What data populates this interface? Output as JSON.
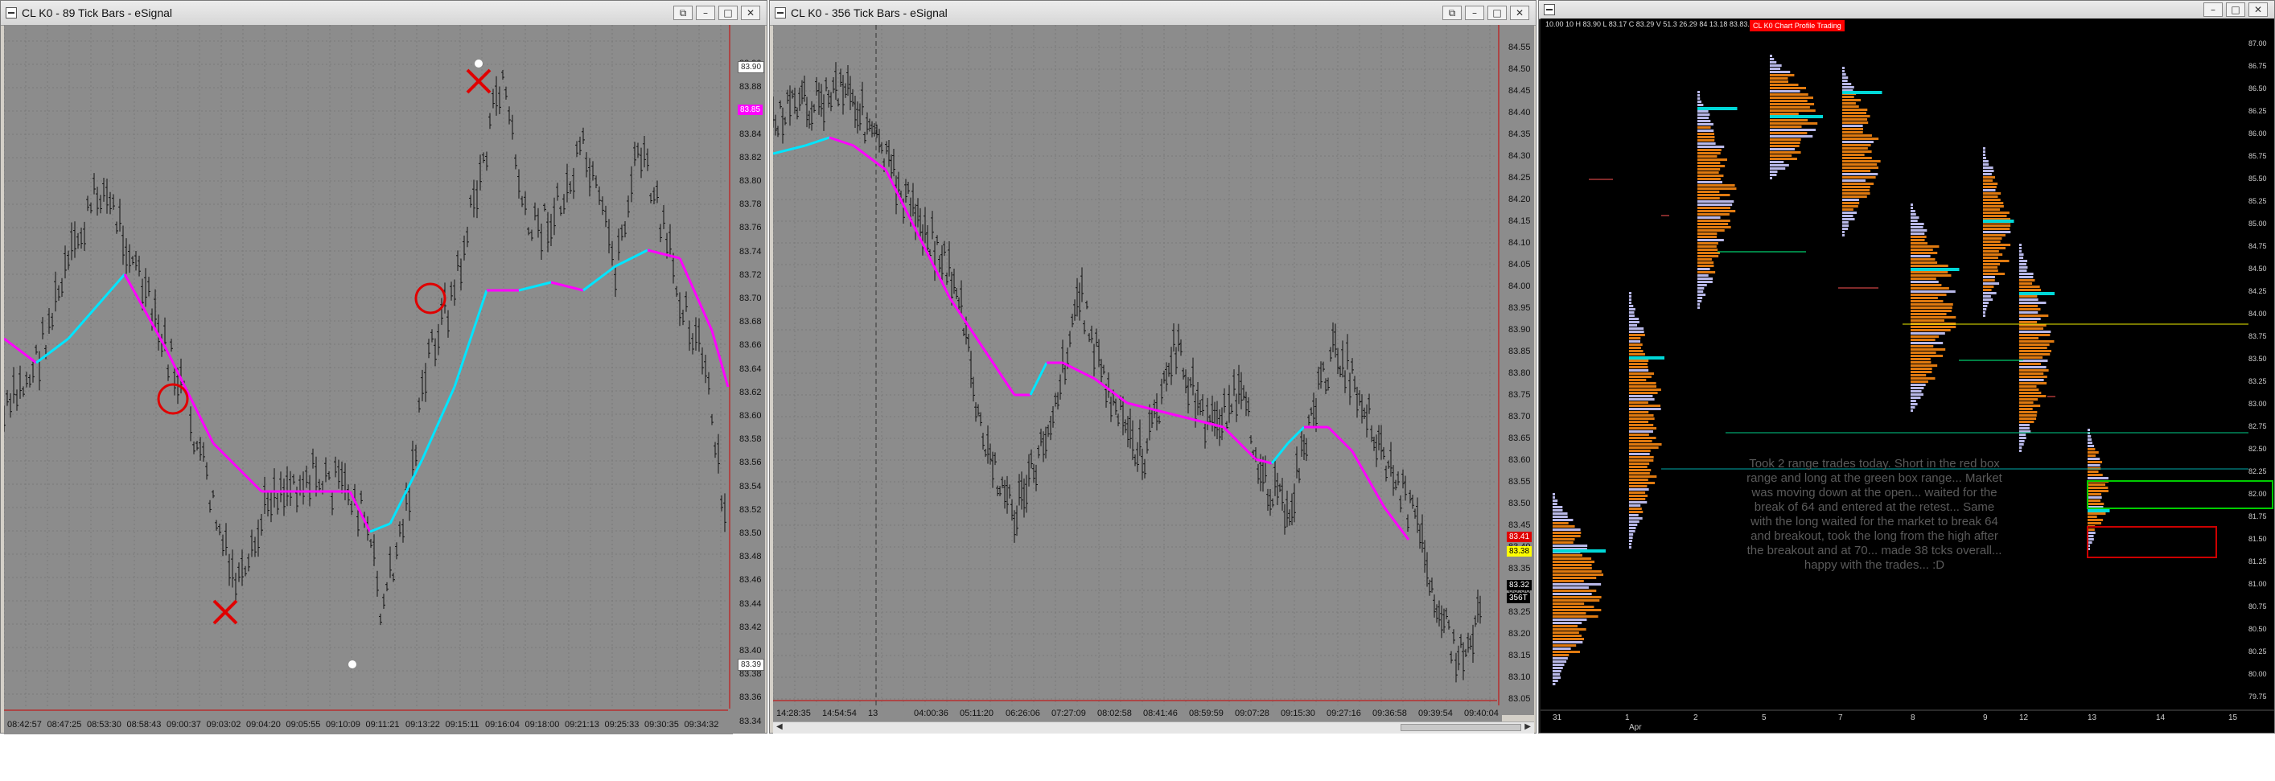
{
  "left_chart": {
    "title": "CL K0 - 89 Tick Bars - eSignal",
    "buttons": [
      "⧉",
      "–",
      "□",
      "✕"
    ],
    "price_labels": [
      "83.90",
      "83.88",
      "83.86",
      "83.84",
      "83.82",
      "83.80",
      "83.78",
      "83.76",
      "83.74",
      "83.72",
      "83.70",
      "83.68",
      "83.66",
      "83.64",
      "83.62",
      "83.60",
      "83.58",
      "83.56",
      "83.54",
      "83.52",
      "83.50",
      "83.48",
      "83.46",
      "83.44",
      "83.42",
      "83.40",
      "83.38",
      "83.36",
      "83.34"
    ],
    "time_labels": [
      "08:42:57",
      "08:47:25",
      "08:53:30",
      "08:58:43",
      "09:00:37",
      "09:03:02",
      "09:04:20",
      "09:05:55",
      "09:10:09",
      "09:11:21",
      "09:13:22",
      "09:15:11",
      "09:16:04",
      "09:18:00",
      "09:21:13",
      "09:25:33",
      "09:30:35",
      "09:34:32"
    ],
    "tags": [
      "83.90",
      "83.85",
      "83.39"
    ],
    "colors": {
      "ma_down": "#ff00ff",
      "ma_up": "#00e5ff",
      "annotation": "#e00000",
      "bar": "#111111"
    }
  },
  "middle_chart": {
    "title": "CL K0 - 356 Tick Bars - eSignal",
    "buttons": [
      "⧉",
      "–",
      "□",
      "✕"
    ],
    "price_labels": [
      "84.55",
      "84.50",
      "84.45",
      "84.40",
      "84.35",
      "84.30",
      "84.25",
      "84.20",
      "84.15",
      "84.10",
      "84.05",
      "84.00",
      "83.95",
      "83.90",
      "83.85",
      "83.80",
      "83.75",
      "83.70",
      "83.65",
      "83.60",
      "83.55",
      "83.50",
      "83.45",
      "83.40",
      "83.35",
      "83.30",
      "83.25",
      "83.20",
      "83.15",
      "83.10",
      "83.05"
    ],
    "time_labels": [
      "14:28:35",
      "14:54:54",
      "13",
      "04:00:36",
      "05:11:20",
      "06:26:06",
      "07:27:09",
      "08:02:58",
      "08:41:46",
      "08:59:59",
      "09:07:28",
      "09:15:30",
      "09:27:16",
      "09:36:58",
      "09:39:54",
      "09:40:04"
    ],
    "tags": [
      "83.41",
      "83.38",
      "83.32",
      "356T"
    ],
    "colors": {
      "ma_down": "#ff00ff",
      "ma_up": "#00e5ff"
    }
  },
  "right_chart": {
    "header_info": "10.00  10  H 83.90  L 83.17  C 83.29  V 51.3  26.29  84 13.18  83.83.69  80.0",
    "red_badge": "CL K0 Chart Profile Trading",
    "note": "Took 2 range trades today. Short in the red box range and long at the green box range... Market was moving down at the open... waited for the break of 64 and entered at the retest... Same with the long waited for the market to break 64 and breakout, took the long from the high after the breakout and at 70... made 38 tcks overall... happy with the trades... :D",
    "date_labels": [
      "31",
      "1",
      "2",
      "5",
      "7",
      "8",
      "9",
      "12",
      "13",
      "14",
      "15"
    ],
    "month_label": "Apr",
    "price_labels": [
      "87.00",
      "86.75",
      "86.50",
      "86.25",
      "86.00",
      "85.75",
      "85.50",
      "85.25",
      "85.00",
      "84.75",
      "84.50",
      "84.25",
      "84.00",
      "83.75",
      "83.50",
      "83.25",
      "83.00",
      "82.75",
      "82.50",
      "82.25",
      "82.00",
      "81.75",
      "81.50",
      "81.25",
      "81.00",
      "80.75",
      "80.50",
      "80.25",
      "80.00",
      "79.75"
    ],
    "colors": {
      "profile": "#e07a10",
      "profile_alt": "#b8b8e8",
      "poc": "#00d8d8",
      "green_box": "#00cc00",
      "red_box": "#cc0000"
    }
  }
}
